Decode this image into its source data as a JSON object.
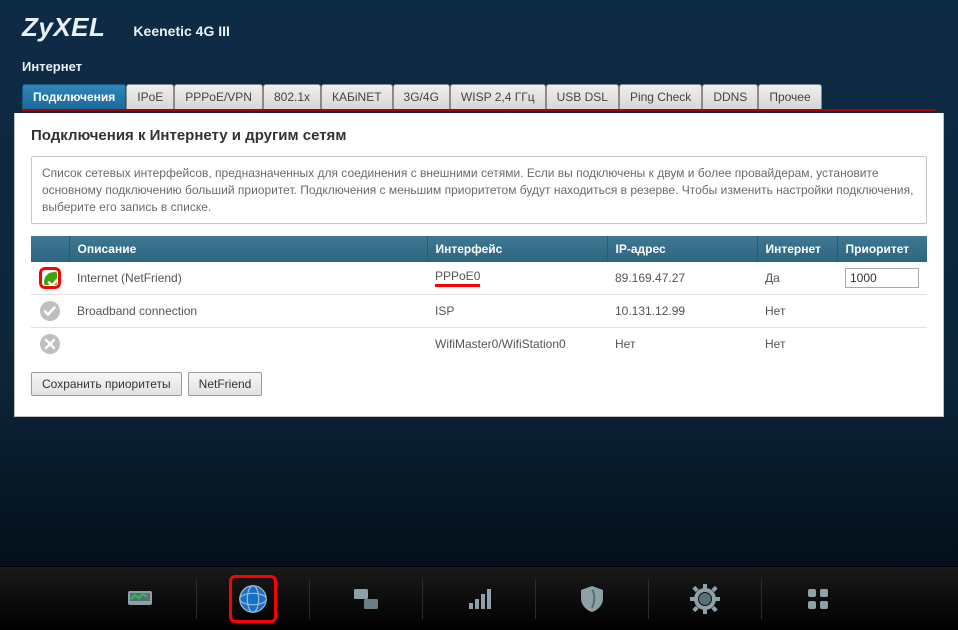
{
  "brand": "ZyXEL",
  "model": "Keenetic 4G III",
  "section": "Интернет",
  "tabs": [
    {
      "label": "Подключения",
      "active": true
    },
    {
      "label": "IPoE"
    },
    {
      "label": "PPPoE/VPN"
    },
    {
      "label": "802.1x"
    },
    {
      "label": "КАБiNET"
    },
    {
      "label": "3G/4G"
    },
    {
      "label": "WISP 2,4 ГГц"
    },
    {
      "label": "USB DSL"
    },
    {
      "label": "Ping Check"
    },
    {
      "label": "DDNS"
    },
    {
      "label": "Прочее"
    }
  ],
  "card": {
    "title": "Подключения к Интернету и другим сетям",
    "description": "Список сетевых интерфейсов, предназначенных для соединения с внешними сетями. Если вы подключены к двум и более провайдерам, установите основному подключению больший приоритет. Подключения с меньшим приоритетом будут находиться в резерве. Чтобы изменить настройки подключения, выберите его запись в списке."
  },
  "columns": {
    "status": "",
    "desc": "Описание",
    "iface": "Интерфейс",
    "ip": "IP-адрес",
    "internet": "Интернет",
    "priority": "Приоритет"
  },
  "rows": [
    {
      "status": "ok",
      "desc": "Internet (NetFriend)",
      "iface": "PPPoE0",
      "ip": "89.169.47.27",
      "internet": "Да",
      "priority": "1000",
      "highlight": true,
      "underlineIface": true
    },
    {
      "status": "off",
      "desc": "Broadband connection",
      "iface": "ISP",
      "ip": "10.131.12.99",
      "internet": "Нет",
      "priority": ""
    },
    {
      "status": "x",
      "desc": "",
      "iface": "WifiMaster0/WifiStation0",
      "ip": "Нет",
      "internet": "Нет",
      "priority": ""
    }
  ],
  "buttons": {
    "save": "Сохранить приоритеты",
    "netfriend": "NetFriend"
  },
  "dock": [
    {
      "name": "monitor-icon",
      "highlight": false
    },
    {
      "name": "globe-icon",
      "highlight": true,
      "active": true
    },
    {
      "name": "network-icon"
    },
    {
      "name": "wifi-icon"
    },
    {
      "name": "shield-icon"
    },
    {
      "name": "gear-icon"
    },
    {
      "name": "apps-icon"
    }
  ]
}
